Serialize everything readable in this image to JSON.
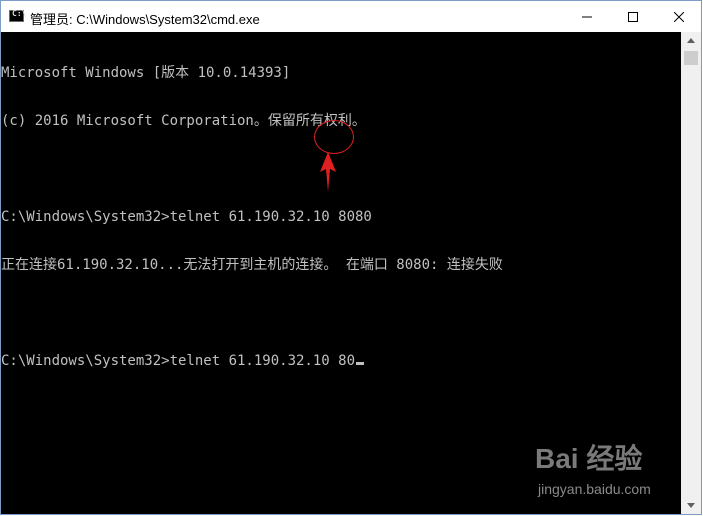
{
  "window": {
    "icon_text": "C:\\",
    "title": "管理员: C:\\Windows\\System32\\cmd.exe",
    "minimize_glyph": "—",
    "maximize_glyph": "☐",
    "close_glyph": "✕"
  },
  "console": {
    "lines": [
      "Microsoft Windows [版本 10.0.14393]",
      "(c) 2016 Microsoft Corporation。保留所有权利。",
      "",
      "C:\\Windows\\System32>telnet 61.190.32.10 8080",
      "正在连接61.190.32.10...无法打开到主机的连接。 在端口 8080: 连接失败",
      "",
      "C:\\Windows\\System32>telnet 61.190.32.10 80"
    ]
  },
  "watermark": {
    "logo": "Bai 经验",
    "url": "jingyan.baidu.com"
  },
  "colors": {
    "console_bg": "#000000",
    "console_text": "#c0c0c0",
    "annotation": "#e02020"
  },
  "icons": [
    "cmd-app-icon",
    "minimize-icon",
    "maximize-icon",
    "close-icon",
    "scroll-up-icon",
    "scroll-down-icon",
    "annotation-arrow-icon"
  ]
}
